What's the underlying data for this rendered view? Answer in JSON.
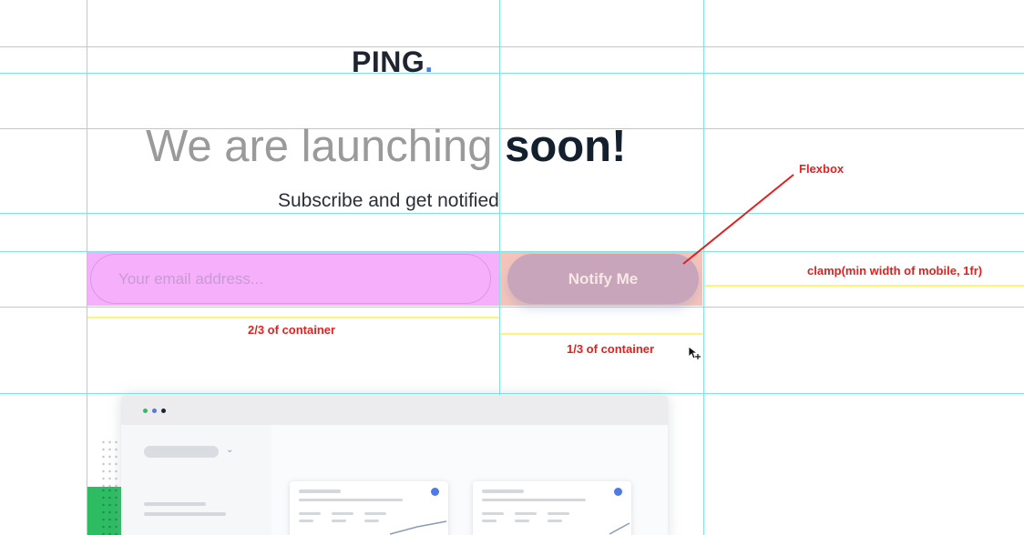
{
  "brand": {
    "name": "PING",
    "dot": "."
  },
  "hero": {
    "title_light": "We are launching ",
    "title_bold": "soon!",
    "subtitle": "Subscribe and get notified"
  },
  "form": {
    "email_placeholder": "Your email address...",
    "notify_label": "Notify Me"
  },
  "annotations": {
    "flexbox": "Flexbox",
    "clamp": "clamp(min width of mobile, 1fr)",
    "two_thirds": "2/3 of container",
    "one_third": "1/3 of container"
  },
  "colors": {
    "accent_blue": "#4e7ae5",
    "guide_cyan": "#7fe3e8",
    "guide_yellow": "#fff37a",
    "annotation_red": "#e02121",
    "email_cell": "#f6b0fb",
    "button_cell": "#f4c4bb",
    "illustration_green": "#2dbc62"
  },
  "icons": {
    "cursor": "move-cursor-icon",
    "window_dots": "window-controls-icon",
    "chevron": "chevron-down-icon",
    "check": "check-circle-icon"
  }
}
